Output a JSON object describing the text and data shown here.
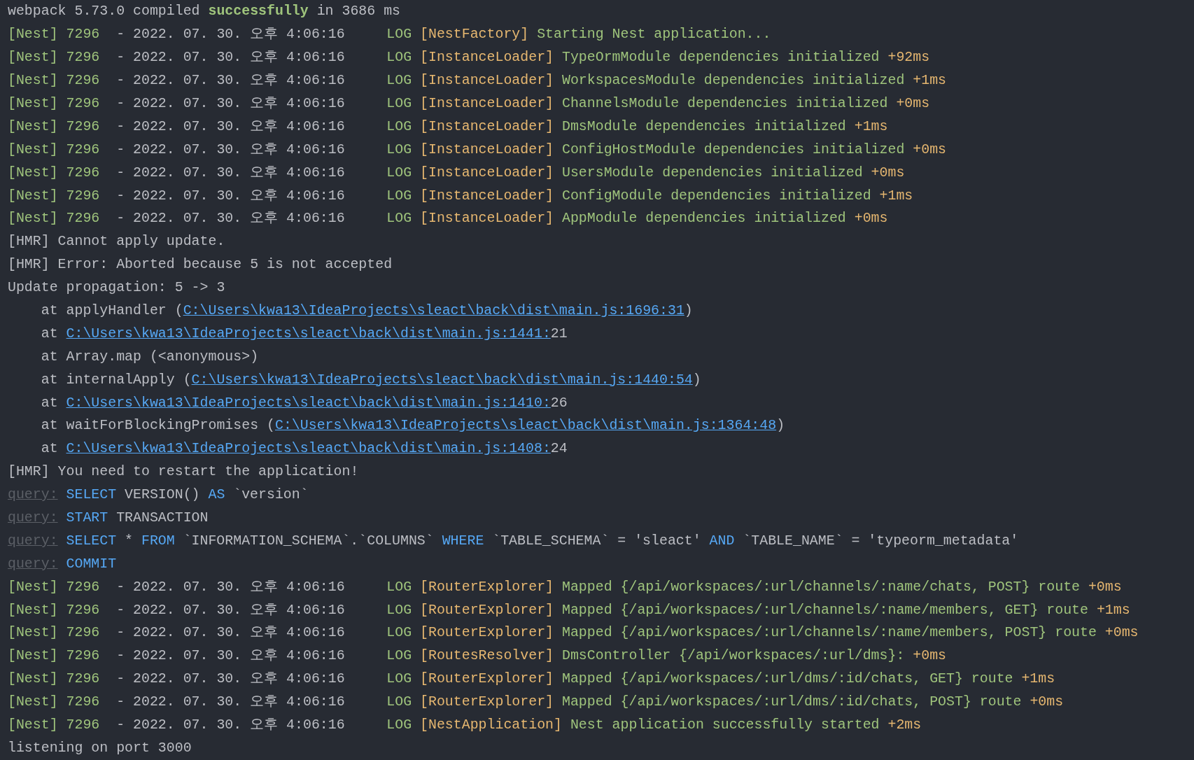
{
  "lines": [
    {
      "kind": "webpack",
      "before": "webpack 5.73.0 compiled",
      "highlight": "successfully",
      "after": "in 3686 ms"
    },
    {
      "kind": "nest",
      "tag": "[Nest]",
      "pid": "7296",
      "time": "- 2022. 07. 30. 오후 4:06:16",
      "level": "LOG",
      "context": "[NestFactory]",
      "message": "Starting Nest application..."
    },
    {
      "kind": "nest",
      "tag": "[Nest]",
      "pid": "7296",
      "time": "- 2022. 07. 30. 오후 4:06:16",
      "level": "LOG",
      "context": "[InstanceLoader]",
      "message": "TypeOrmModule dependencies initialized",
      "timing": "+92ms"
    },
    {
      "kind": "nest",
      "tag": "[Nest]",
      "pid": "7296",
      "time": "- 2022. 07. 30. 오후 4:06:16",
      "level": "LOG",
      "context": "[InstanceLoader]",
      "message": "WorkspacesModule dependencies initialized",
      "timing": "+1ms"
    },
    {
      "kind": "nest",
      "tag": "[Nest]",
      "pid": "7296",
      "time": "- 2022. 07. 30. 오후 4:06:16",
      "level": "LOG",
      "context": "[InstanceLoader]",
      "message": "ChannelsModule dependencies initialized",
      "timing": "+0ms"
    },
    {
      "kind": "nest",
      "tag": "[Nest]",
      "pid": "7296",
      "time": "- 2022. 07. 30. 오후 4:06:16",
      "level": "LOG",
      "context": "[InstanceLoader]",
      "message": "DmsModule dependencies initialized",
      "timing": "+1ms"
    },
    {
      "kind": "nest",
      "tag": "[Nest]",
      "pid": "7296",
      "time": "- 2022. 07. 30. 오후 4:06:16",
      "level": "LOG",
      "context": "[InstanceLoader]",
      "message": "ConfigHostModule dependencies initialized",
      "timing": "+0ms"
    },
    {
      "kind": "nest",
      "tag": "[Nest]",
      "pid": "7296",
      "time": "- 2022. 07. 30. 오후 4:06:16",
      "level": "LOG",
      "context": "[InstanceLoader]",
      "message": "UsersModule dependencies initialized",
      "timing": "+0ms"
    },
    {
      "kind": "nest",
      "tag": "[Nest]",
      "pid": "7296",
      "time": "- 2022. 07. 30. 오후 4:06:16",
      "level": "LOG",
      "context": "[InstanceLoader]",
      "message": "ConfigModule dependencies initialized",
      "timing": "+1ms"
    },
    {
      "kind": "nest",
      "tag": "[Nest]",
      "pid": "7296",
      "time": "- 2022. 07. 30. 오후 4:06:16",
      "level": "LOG",
      "context": "[InstanceLoader]",
      "message": "AppModule dependencies initialized",
      "timing": "+0ms"
    },
    {
      "kind": "plain",
      "text": "[HMR] Cannot apply update."
    },
    {
      "kind": "plain",
      "text": "[HMR] Error: Aborted because 5 is not accepted"
    },
    {
      "kind": "plain",
      "text": "Update propagation: 5 -> 3"
    },
    {
      "kind": "trace",
      "before": "at applyHandler (",
      "link": "C:\\Users\\kwa13\\IdeaProjects\\sleact\\back\\dist\\main.js:1696:31",
      "after": ")"
    },
    {
      "kind": "trace",
      "before": "at",
      "link": "C:\\Users\\kwa13\\IdeaProjects\\sleact\\back\\dist\\main.js:1441:",
      "after": "21"
    },
    {
      "kind": "trace",
      "before": "at Array.map (<anonymous>)"
    },
    {
      "kind": "trace",
      "before": "at internalApply (",
      "link": "C:\\Users\\kwa13\\IdeaProjects\\sleact\\back\\dist\\main.js:1440:54",
      "after": ")"
    },
    {
      "kind": "trace",
      "before": "at",
      "link": "C:\\Users\\kwa13\\IdeaProjects\\sleact\\back\\dist\\main.js:1410:",
      "after": "26"
    },
    {
      "kind": "trace",
      "before": "at waitForBlockingPromises (",
      "link": "C:\\Users\\kwa13\\IdeaProjects\\sleact\\back\\dist\\main.js:1364:48",
      "after": ")"
    },
    {
      "kind": "trace",
      "before": "at",
      "link": "C:\\Users\\kwa13\\IdeaProjects\\sleact\\back\\dist\\main.js:1408:",
      "after": "24"
    },
    {
      "kind": "plain",
      "text": "[HMR] You need to restart the application!"
    },
    {
      "kind": "query",
      "label": "query:",
      "tokens": [
        {
          "keyword": true,
          "text": "SELECT"
        },
        {
          "keyword": false,
          "text": "VERSION()"
        },
        {
          "keyword": true,
          "text": "AS"
        },
        {
          "keyword": false,
          "text": "`version`"
        }
      ]
    },
    {
      "kind": "query",
      "label": "query:",
      "tokens": [
        {
          "keyword": true,
          "text": "START"
        },
        {
          "keyword": false,
          "text": "TRANSACTION"
        }
      ]
    },
    {
      "kind": "query",
      "label": "query:",
      "tokens": [
        {
          "keyword": true,
          "text": "SELECT"
        },
        {
          "keyword": false,
          "text": "*"
        },
        {
          "keyword": true,
          "text": "FROM"
        },
        {
          "keyword": false,
          "text": "`INFORMATION_SCHEMA`.`COLUMNS`"
        },
        {
          "keyword": true,
          "text": "WHERE"
        },
        {
          "keyword": false,
          "text": "`TABLE_SCHEMA` = 'sleact'"
        },
        {
          "keyword": true,
          "text": "AND"
        },
        {
          "keyword": false,
          "text": "`TABLE_NAME` = 'typeorm_metadata'"
        }
      ]
    },
    {
      "kind": "query",
      "label": "query:",
      "tokens": [
        {
          "keyword": true,
          "text": "COMMIT"
        }
      ]
    },
    {
      "kind": "nest",
      "tag": "[Nest]",
      "pid": "7296",
      "time": "- 2022. 07. 30. 오후 4:06:16",
      "level": "LOG",
      "context": "[RouterExplorer]",
      "message": "Mapped {/api/workspaces/:url/channels/:name/chats, POST} route",
      "timing": "+0ms"
    },
    {
      "kind": "nest",
      "tag": "[Nest]",
      "pid": "7296",
      "time": "- 2022. 07. 30. 오후 4:06:16",
      "level": "LOG",
      "context": "[RouterExplorer]",
      "message": "Mapped {/api/workspaces/:url/channels/:name/members, GET} route",
      "timing": "+1ms"
    },
    {
      "kind": "nest",
      "tag": "[Nest]",
      "pid": "7296",
      "time": "- 2022. 07. 30. 오후 4:06:16",
      "level": "LOG",
      "context": "[RouterExplorer]",
      "message": "Mapped {/api/workspaces/:url/channels/:name/members, POST} route",
      "timing": "+0ms"
    },
    {
      "kind": "nest",
      "tag": "[Nest]",
      "pid": "7296",
      "time": "- 2022. 07. 30. 오후 4:06:16",
      "level": "LOG",
      "context": "[RoutesResolver]",
      "message": "DmsController {/api/workspaces/:url/dms}:",
      "timing": "+0ms"
    },
    {
      "kind": "nest",
      "tag": "[Nest]",
      "pid": "7296",
      "time": "- 2022. 07. 30. 오후 4:06:16",
      "level": "LOG",
      "context": "[RouterExplorer]",
      "message": "Mapped {/api/workspaces/:url/dms/:id/chats, GET} route",
      "timing": "+1ms"
    },
    {
      "kind": "nest",
      "tag": "[Nest]",
      "pid": "7296",
      "time": "- 2022. 07. 30. 오후 4:06:16",
      "level": "LOG",
      "context": "[RouterExplorer]",
      "message": "Mapped {/api/workspaces/:url/dms/:id/chats, POST} route",
      "timing": "+0ms"
    },
    {
      "kind": "nest",
      "tag": "[Nest]",
      "pid": "7296",
      "time": "- 2022. 07. 30. 오후 4:06:16",
      "level": "LOG",
      "context": "[NestApplication]",
      "message": "Nest application successfully started",
      "timing": "+2ms"
    },
    {
      "kind": "plain",
      "text": "listening on port 3000"
    }
  ]
}
